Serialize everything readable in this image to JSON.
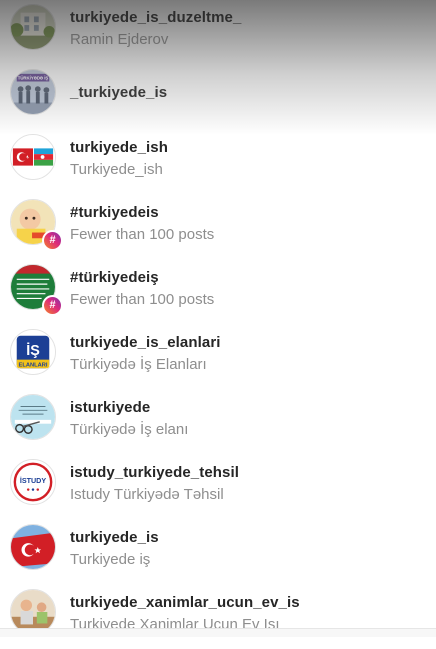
{
  "results": [
    {
      "title": "turkiyede_is_duzeltme_",
      "subtitle": "Ramin Ejderov",
      "icon": "building-photo-avatar"
    },
    {
      "title": "_turkiyede_is",
      "subtitle": "",
      "avatar_text": "TÜRKİYƏDƏ İŞ",
      "icon": "silhouettes-avatar"
    },
    {
      "title": "turkiyede_ish",
      "subtitle": "Turkiyede_ish",
      "icon": "flags-avatar"
    },
    {
      "title": "#turkiyedeis",
      "subtitle": "Fewer than 100 posts",
      "icon": "baby-photo-avatar"
    },
    {
      "title": "#türkiyedeiş",
      "subtitle": "Fewer than 100 posts",
      "icon": "green-poster-avatar"
    },
    {
      "title": "turkiyede_is_elanlari",
      "subtitle": "Türkiyədə İş Elanları",
      "avatar_text": "İŞ",
      "avatar_sub": "ELANLARI",
      "icon": "is-elanlari-logo-avatar"
    },
    {
      "title": "isturkiyede",
      "subtitle": "Türkiyədə İş elanı",
      "icon": "scissors-avatar"
    },
    {
      "title": "istudy_turkiyede_tehsil",
      "subtitle": "Istudy Türkiyədə Təhsil",
      "avatar_text": "İSTUDY",
      "icon": "istudy-logo-avatar"
    },
    {
      "title": "turkiyede_is",
      "subtitle": "Turkiyede iş",
      "icon": "turkish-flag-avatar"
    },
    {
      "title": "turkiyede_xanimlar_ucun_ev_is",
      "subtitle": "Turkiyede Xanimlar Ucun Ev Işı",
      "icon": "kitchen-photo-avatar"
    }
  ],
  "hashtag_badge": "#"
}
